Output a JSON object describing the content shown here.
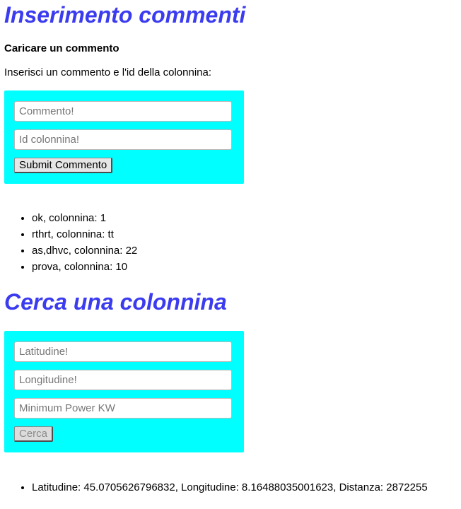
{
  "comments_section": {
    "title": "Inserimento commenti",
    "subheading": "Caricare un commento",
    "instructions": "Inserisci un commento e l'id della colonnina:",
    "form": {
      "comment_placeholder": "Commento!",
      "station_id_placeholder": "Id colonnina!",
      "submit_label": "Submit Commento"
    },
    "comments": [
      "ok, colonnina: 1",
      "rthrt, colonnina: tt",
      "as,dhvc, colonnina: 22",
      "prova, colonnina: 10"
    ]
  },
  "search_section": {
    "title": "Cerca una colonnina",
    "form": {
      "latitude_placeholder": "Latitudine!",
      "longitude_placeholder": "Longitudine!",
      "power_placeholder": "Minimum Power KW",
      "search_label": "Cerca"
    },
    "results": [
      "Latitudine: 45.0705626796832, Longitudine: 8.16488035001623, Distanza: 2872255"
    ]
  },
  "colors": {
    "heading": "#3b3bf0",
    "panel": "#00ffff"
  }
}
